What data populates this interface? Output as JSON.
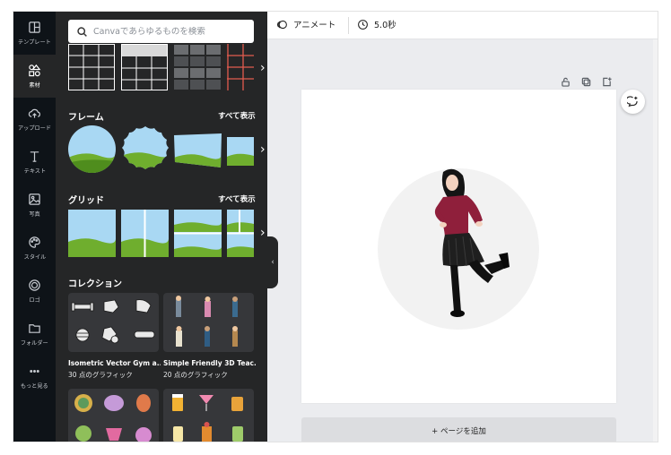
{
  "rail": {
    "items": [
      {
        "label": "テンプレート",
        "icon": "layout-icon"
      },
      {
        "label": "素材",
        "icon": "shapes-icon"
      },
      {
        "label": "アップロード",
        "icon": "upload-cloud-icon"
      },
      {
        "label": "テキスト",
        "icon": "text-icon"
      },
      {
        "label": "写真",
        "icon": "photo-icon"
      },
      {
        "label": "スタイル",
        "icon": "palette-icon"
      },
      {
        "label": "ロゴ",
        "icon": "logo-icon"
      },
      {
        "label": "フォルダー",
        "icon": "folder-icon"
      },
      {
        "label": "もっと見る",
        "icon": "more-icon"
      }
    ],
    "active_index": 1
  },
  "panel": {
    "search_placeholder": "Canvaであらゆるものを検索",
    "frames": {
      "title": "フレーム",
      "see_all": "すべて表示"
    },
    "grids": {
      "title": "グリッド",
      "see_all": "すべて表示"
    },
    "collections": {
      "title": "コレクション",
      "items": [
        {
          "name": "Isometric Vector Gym a...",
          "count": "30 点のグラフィック"
        },
        {
          "name": "Simple Friendly 3D Teac...",
          "count": "20 点のグラフィック"
        }
      ]
    }
  },
  "topbar": {
    "animate_label": "アニメート",
    "duration_label": "5.0秒"
  },
  "canvas": {
    "add_page_label": "+ ページを追加"
  },
  "colors": {
    "rail_bg": "#0e1318",
    "panel_bg": "#252627",
    "canvas_bg": "#ebecef",
    "sky": "#a9d8f3",
    "grass": "#6fae2e"
  }
}
